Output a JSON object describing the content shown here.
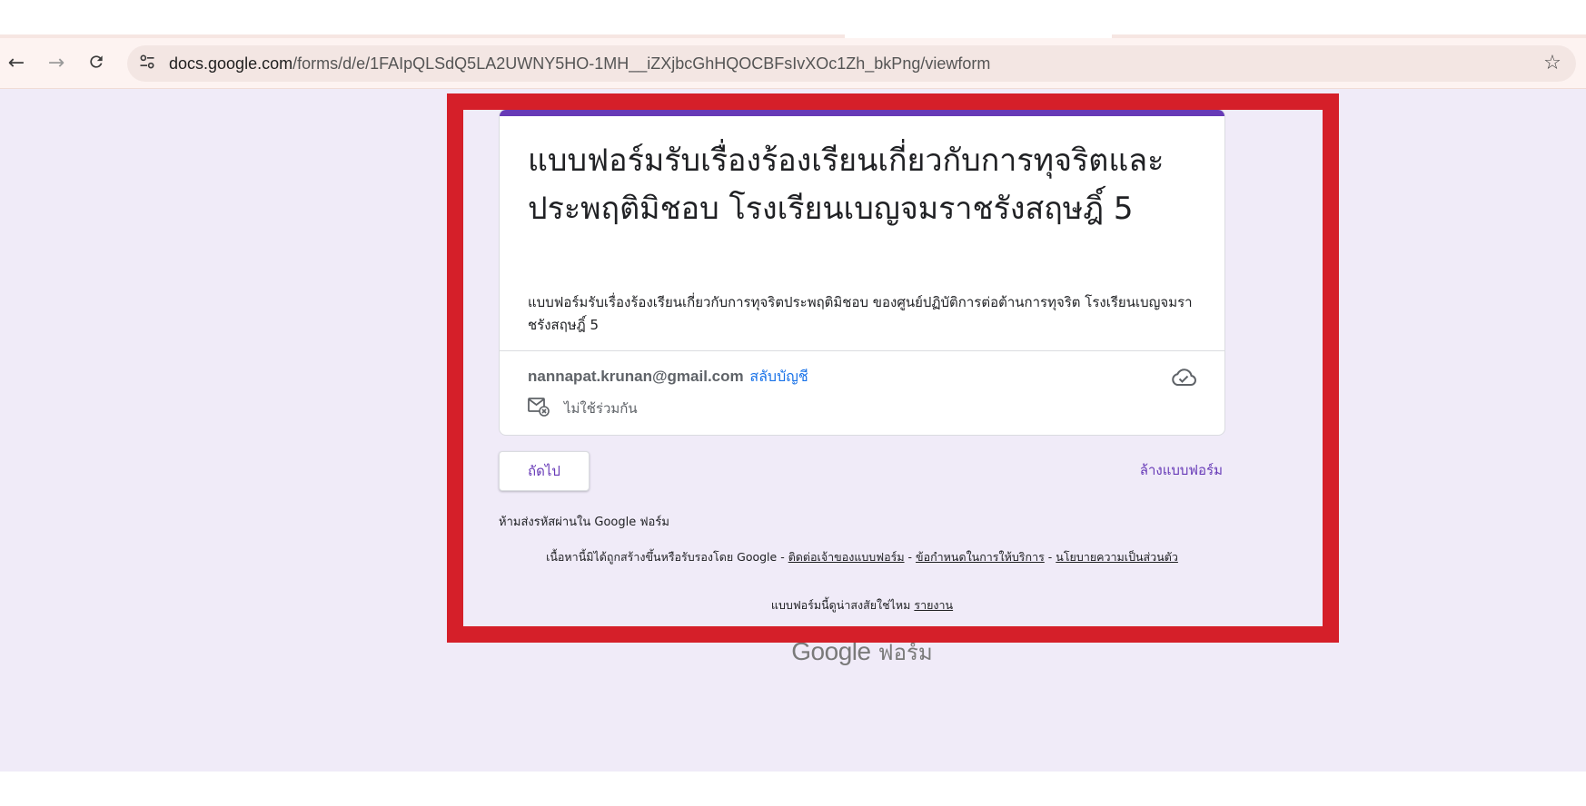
{
  "browser": {
    "url_host": "docs.google.com",
    "url_path": "/forms/d/e/1FAIpQLSdQ5LA2UWNY5HO-1MH__iZXjbcGhHQOCBFsIvXOc1Zh_bkPng/viewform",
    "icons": {
      "back": "arrow-left-icon",
      "forward": "arrow-right-icon",
      "reload": "reload-icon",
      "site_info": "tune-icon",
      "bookmark": "star-icon"
    }
  },
  "form": {
    "title": "แบบฟอร์มรับเรื่องร้องเรียนเกี่ยวกับการทุจริตและประพฤติมิชอบ โรงเรียนเบญจมราชรังสฤษฎิ์ 5",
    "description": "แบบฟอร์มรับเรื่องร้องเรียนเกี่ยวกับการทุจริตประพฤติมิชอบ ของศูนย์ปฏิบัติการต่อต้านการทุจริต โรงเรียนเบญจมราชรังสฤษฎิ์ 5",
    "account_email": "nannapat.krunan@gmail.com",
    "switch_account": "สลับบัญชี",
    "not_shared": "ไม่ใช้ร่วมกัน",
    "next_button": "ถัดไป",
    "clear_form": "ล้างแบบฟอร์ม",
    "password_warning": "ห้ามส่งรหัสผ่านใน Google ฟอร์ม"
  },
  "footer": {
    "disclaimer_prefix": "เนื้อหานี้มิได้ถูกสร้างขึ้นหรือรับรองโดย Google - ",
    "contact_owner": "ติดต่อเจ้าของแบบฟอร์ม",
    "sep1": " - ",
    "terms": "ข้อกำหนดในการให้บริการ",
    "sep2": " - ",
    "privacy": "นโยบายความเป็นส่วนตัว",
    "report_prompt": "แบบฟอร์มนี้ดูน่าสงสัยใช่ไหม ",
    "report_link": "รายงาน",
    "brand_google": "Google",
    "brand_forms": "ฟอร์ม"
  },
  "colors": {
    "accent": "#673ab7",
    "highlight_border": "#d51f29",
    "background": "#f0ebf8",
    "link": "#1a73e8"
  }
}
